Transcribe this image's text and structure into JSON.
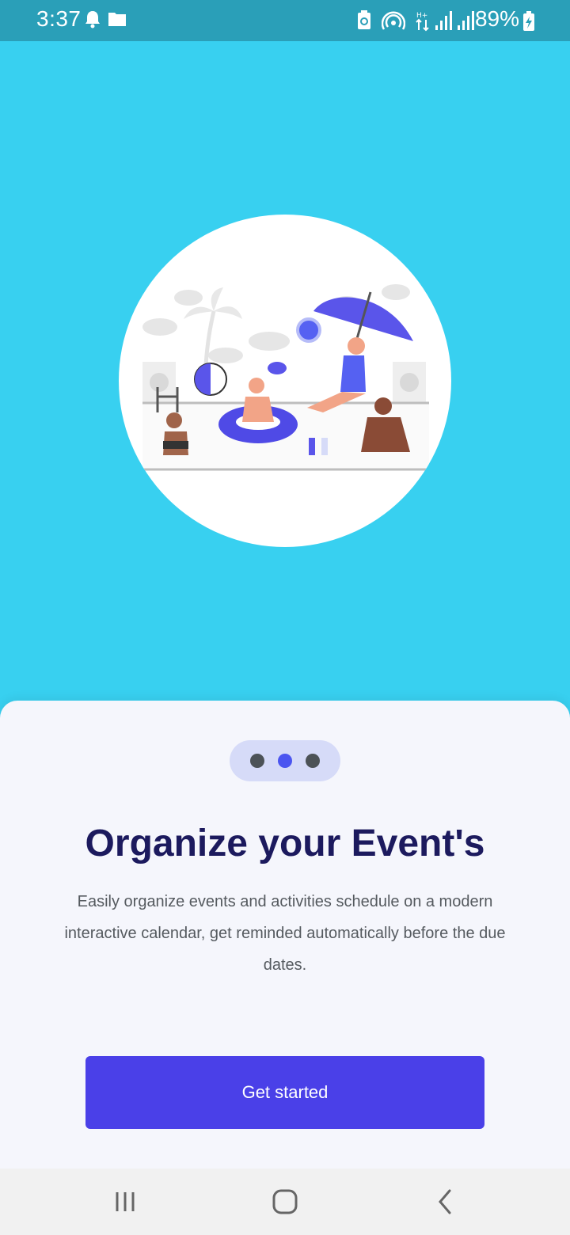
{
  "status_bar": {
    "time": "3:37",
    "battery": "89%",
    "icons": [
      "notification-bell-icon",
      "folder-icon",
      "battery-saver-icon",
      "hotspot-icon",
      "data-arrows-icon",
      "signal-icon",
      "signal-icon-2",
      "battery-charging-icon"
    ]
  },
  "onboarding": {
    "pager": {
      "count": 3,
      "active_index": 1
    },
    "title": "Organize your Event's",
    "description": "Easily organize events and activities schedule on a modern interactive calendar, get reminded automatically before the due dates.",
    "cta_label": "Get started"
  },
  "navigation_bar": {
    "icons": [
      "recent-apps-icon",
      "home-icon",
      "back-icon"
    ]
  },
  "colors": {
    "background": "#38d0f0",
    "status_bar": "#2a9fb8",
    "accent": "#4a40e8",
    "title": "#1c1a5e",
    "pager_active": "#4b55f0"
  }
}
